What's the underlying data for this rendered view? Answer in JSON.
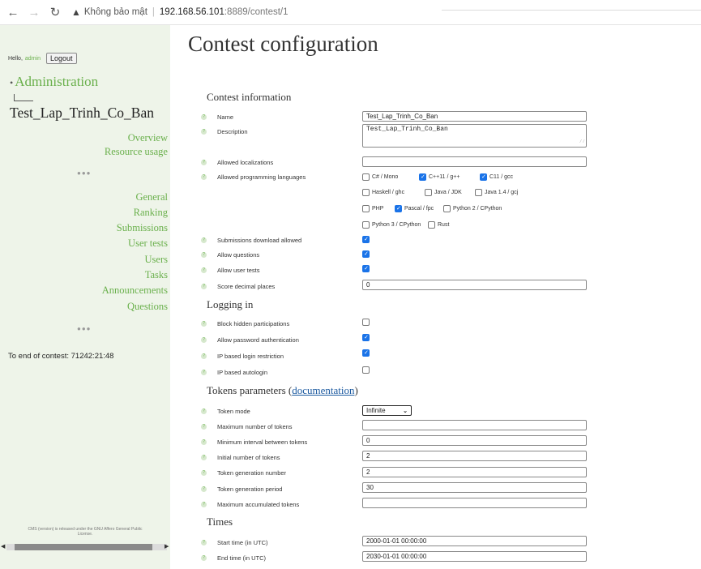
{
  "browser": {
    "security_label": "Không bảo mật",
    "address_host": "192.168.56.101",
    "address_path": ":8889/contest/1"
  },
  "sidebar": {
    "hello_prefix": "Hello,",
    "username": "admin",
    "logout_label": "Logout",
    "admin_link": "Administration",
    "contest_name": "Test_Lap_Trinh_Co_Ban",
    "links_a": [
      "Overview",
      "Resource usage"
    ],
    "links_b": [
      "General",
      "Ranking",
      "Submissions",
      "User tests",
      "Users",
      "Tasks",
      "Announcements",
      "Questions"
    ],
    "end_of_contest": "To end of contest: 71242:21:48",
    "footer_note": "CMS (version) is released under the GNU Affero General Public License."
  },
  "main": {
    "title": "Contest configuration",
    "sections": {
      "contest_info": "Contest information",
      "logging_in": "Logging in",
      "tokens_prefix": "Tokens parameters (",
      "tokens_link": "documentation",
      "tokens_suffix": ")",
      "times": "Times"
    },
    "fields": {
      "name": {
        "label": "Name",
        "value": "Test_Lap_Trinh_Co_Ban"
      },
      "description": {
        "label": "Description",
        "value": "Test_Lap_Trinh_Co_Ban"
      },
      "allowed_localizations": {
        "label": "Allowed localizations",
        "value": ""
      },
      "allowed_languages": {
        "label": "Allowed programming languages"
      },
      "submissions_download": {
        "label": "Submissions download allowed",
        "checked": true
      },
      "allow_questions": {
        "label": "Allow questions",
        "checked": true
      },
      "allow_user_tests": {
        "label": "Allow user tests",
        "checked": true
      },
      "score_decimal": {
        "label": "Score decimal places",
        "value": "0"
      },
      "block_hidden": {
        "label": "Block hidden participations",
        "checked": false
      },
      "allow_password": {
        "label": "Allow password authentication",
        "checked": true
      },
      "ip_restriction": {
        "label": "IP based login restriction",
        "checked": true
      },
      "ip_autologin": {
        "label": "IP based autologin",
        "checked": false
      },
      "token_mode": {
        "label": "Token mode",
        "value": "Infinite"
      },
      "max_tokens": {
        "label": "Maximum number of tokens",
        "value": ""
      },
      "min_interval": {
        "label": "Minimum interval between tokens",
        "value": "0"
      },
      "initial_tokens": {
        "label": "Initial number of tokens",
        "value": "2"
      },
      "gen_number": {
        "label": "Token generation number",
        "value": "2"
      },
      "gen_period": {
        "label": "Token generation period",
        "value": "30"
      },
      "max_accumulated": {
        "label": "Maximum accumulated tokens",
        "value": ""
      },
      "start_time": {
        "label": "Start time (in UTC)",
        "value": "2000-01-01 00:00:00"
      },
      "end_time": {
        "label": "End time (in UTC)",
        "value": "2030-01-01 00:00:00"
      }
    },
    "languages": [
      {
        "label": "C# / Mono",
        "checked": false
      },
      {
        "label": "C++11 / g++",
        "checked": true
      },
      {
        "label": "C11 / gcc",
        "checked": true
      },
      {
        "label": "Haskell / ghc",
        "checked": false
      },
      {
        "label": "Java / JDK",
        "checked": false
      },
      {
        "label": "Java 1.4 / gcj",
        "checked": false
      },
      {
        "label": "PHP",
        "checked": false
      },
      {
        "label": "Pascal / fpc",
        "checked": true
      },
      {
        "label": "Python 2 / CPython",
        "checked": false
      },
      {
        "label": "Python 3 / CPython",
        "checked": false
      },
      {
        "label": "Rust",
        "checked": false
      }
    ]
  },
  "colors": {
    "accent_green": "#6ab04c",
    "sidebar_bg": "#eef4e9",
    "link_blue": "#1c5aa0",
    "checkbox_blue": "#1a73e8"
  }
}
